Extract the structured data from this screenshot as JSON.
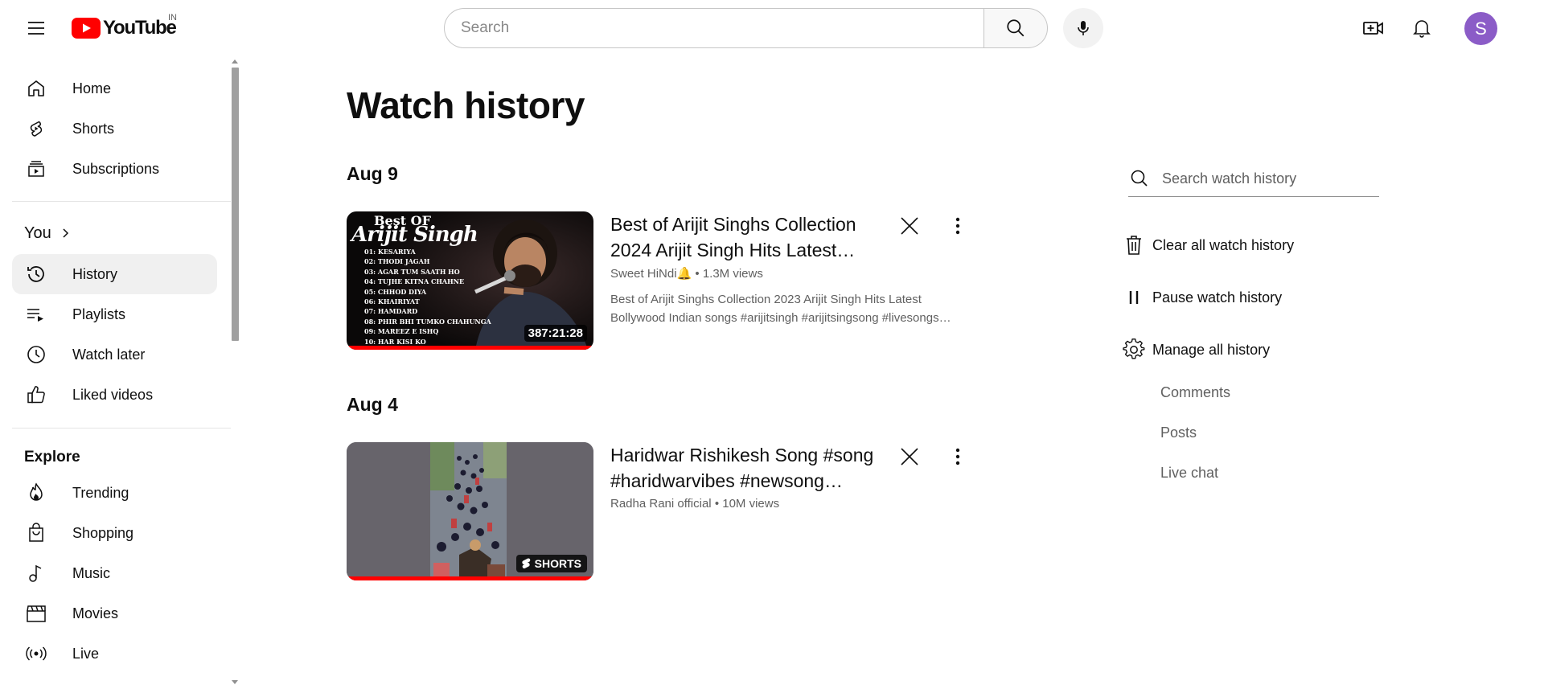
{
  "header": {
    "logo_text": "YouTube",
    "country_code": "IN",
    "search_placeholder": "Search",
    "avatar_initial": "S"
  },
  "sidebar": {
    "primary": [
      {
        "label": "Home",
        "icon": "home-icon"
      },
      {
        "label": "Shorts",
        "icon": "shorts-icon"
      },
      {
        "label": "Subscriptions",
        "icon": "subscriptions-icon"
      }
    ],
    "you_heading": "You",
    "you_items": [
      {
        "label": "History",
        "icon": "history-icon",
        "active": true
      },
      {
        "label": "Playlists",
        "icon": "playlists-icon"
      },
      {
        "label": "Watch later",
        "icon": "watch-later-icon"
      },
      {
        "label": "Liked videos",
        "icon": "liked-videos-icon"
      }
    ],
    "explore_heading": "Explore",
    "explore_items": [
      {
        "label": "Trending",
        "icon": "trending-icon"
      },
      {
        "label": "Shopping",
        "icon": "shopping-icon"
      },
      {
        "label": "Music",
        "icon": "music-icon"
      },
      {
        "label": "Movies",
        "icon": "movies-icon"
      },
      {
        "label": "Live",
        "icon": "live-icon"
      }
    ]
  },
  "main": {
    "title": "Watch history",
    "groups": [
      {
        "date": "Aug 9",
        "videos": [
          {
            "title": "Best of Arijit Singhs Collection 2024 Arijit Singh Hits Latest Bollywood Indian songs",
            "channel": "Sweet HiNdi🔔",
            "views": "1.3M views",
            "description": "Best of Arijit Singhs Collection 2023 Arijit Singh Hits Latest Bollywood Indian songs #arijitsingh #arijitsingsong #livesongs #bollywoodsongs",
            "duration": "387:21:28",
            "thumb": {
              "heading": "Best OF",
              "name": "Arijit Singh",
              "tracklist": [
                "01: KESARIYA",
                "02: THODI JAGAH",
                "03: AGAR TUM SAATH HO",
                "04: TUJHE KITNA CHAHNE",
                "05: CHHOD DIYA",
                "06: KHAIRIYAT",
                "07: HAMDARD",
                "08: PHIR BHI TUMKO CHAHUNGA",
                "09: MAREEZ E ISHQ",
                "10: HAR KISI KO"
              ]
            }
          }
        ]
      },
      {
        "date": "Aug 4",
        "videos": [
          {
            "title": "Haridwar Rishikesh Song #song #haridwarvibes #newsong #shorts",
            "channel": "Radha Rani official",
            "views": "10M views",
            "badge": "SHORTS"
          }
        ]
      }
    ]
  },
  "right_panel": {
    "search_placeholder": "Search watch history",
    "clear_label": "Clear all watch history",
    "pause_label": "Pause watch history",
    "manage_label": "Manage all history",
    "sub_links": [
      "Comments",
      "Posts",
      "Live chat"
    ]
  },
  "colors": {
    "brand_red": "#ff0000",
    "active_bg": "#f0f0f0",
    "avatar": "#8b5cc7",
    "secondary_text": "#606060"
  }
}
